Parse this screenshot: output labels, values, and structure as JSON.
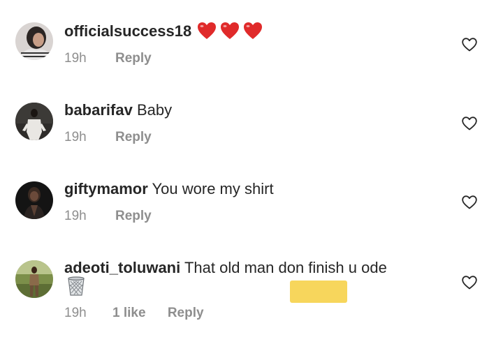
{
  "comments": [
    {
      "username": "officialsuccess18",
      "text": "",
      "time": "19h",
      "likes": "",
      "reply_label": "Reply",
      "emoji": [
        "red-heart",
        "red-heart",
        "red-heart"
      ]
    },
    {
      "username": "babarifav",
      "text": "Baby",
      "time": "19h",
      "likes": "",
      "reply_label": "Reply"
    },
    {
      "username": "giftymamor",
      "text": "You wore my shirt",
      "time": "19h",
      "likes": "",
      "reply_label": "Reply"
    },
    {
      "username": "adeoti_toluwani",
      "text": "That old man don finish u ode",
      "time": "19h",
      "likes": "1 like",
      "reply_label": "Reply",
      "emoji": [
        "wastebasket"
      ]
    }
  ],
  "colors": {
    "text": "#262626",
    "meta": "#8e8e8e",
    "heart": "#e02a2a",
    "highlight": "#f7d65c"
  }
}
